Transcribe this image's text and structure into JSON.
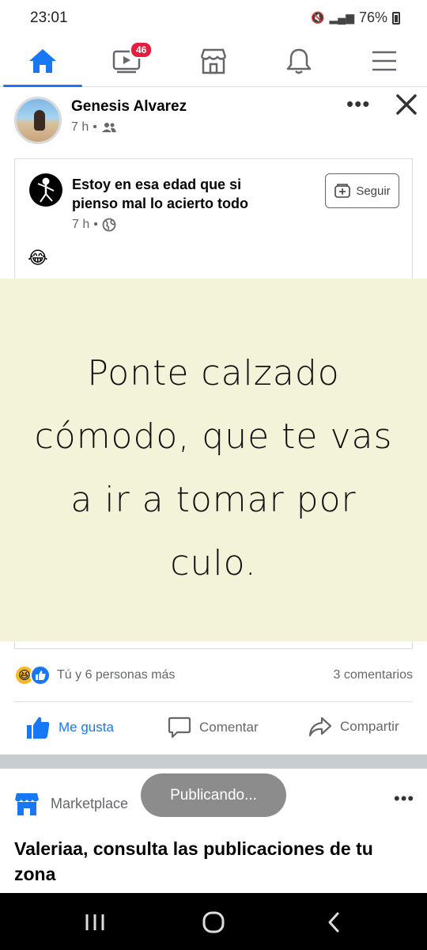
{
  "status_bar": {
    "time": "23:01",
    "battery": "76%"
  },
  "nav": {
    "watch_badge": "46"
  },
  "post": {
    "author": "Genesis Alvarez",
    "time": "7 h",
    "dot": "•"
  },
  "shared": {
    "page_name": "Estoy en esa edad que si pienso mal lo acierto todo",
    "time": "7 h",
    "dot": "•",
    "follow_label": "Seguir",
    "emoji": "😂",
    "meme_text": "Ponte calzado cómodo, que te vas a ir a tomar por culo."
  },
  "reactions": {
    "text": "Tú y 6 personas más",
    "comments": "3 comentarios"
  },
  "actions": {
    "like": "Me gusta",
    "comment": "Comentar",
    "share": "Compartir"
  },
  "marketplace": {
    "label": "Marketplace",
    "title": "Valeriaa, consulta las publicaciones de tu zona"
  },
  "toast": "Publicando...",
  "colors": {
    "brand_blue": "#1877f2",
    "badge_red": "#e41e3f",
    "meme_bg": "#f3f3d9"
  }
}
